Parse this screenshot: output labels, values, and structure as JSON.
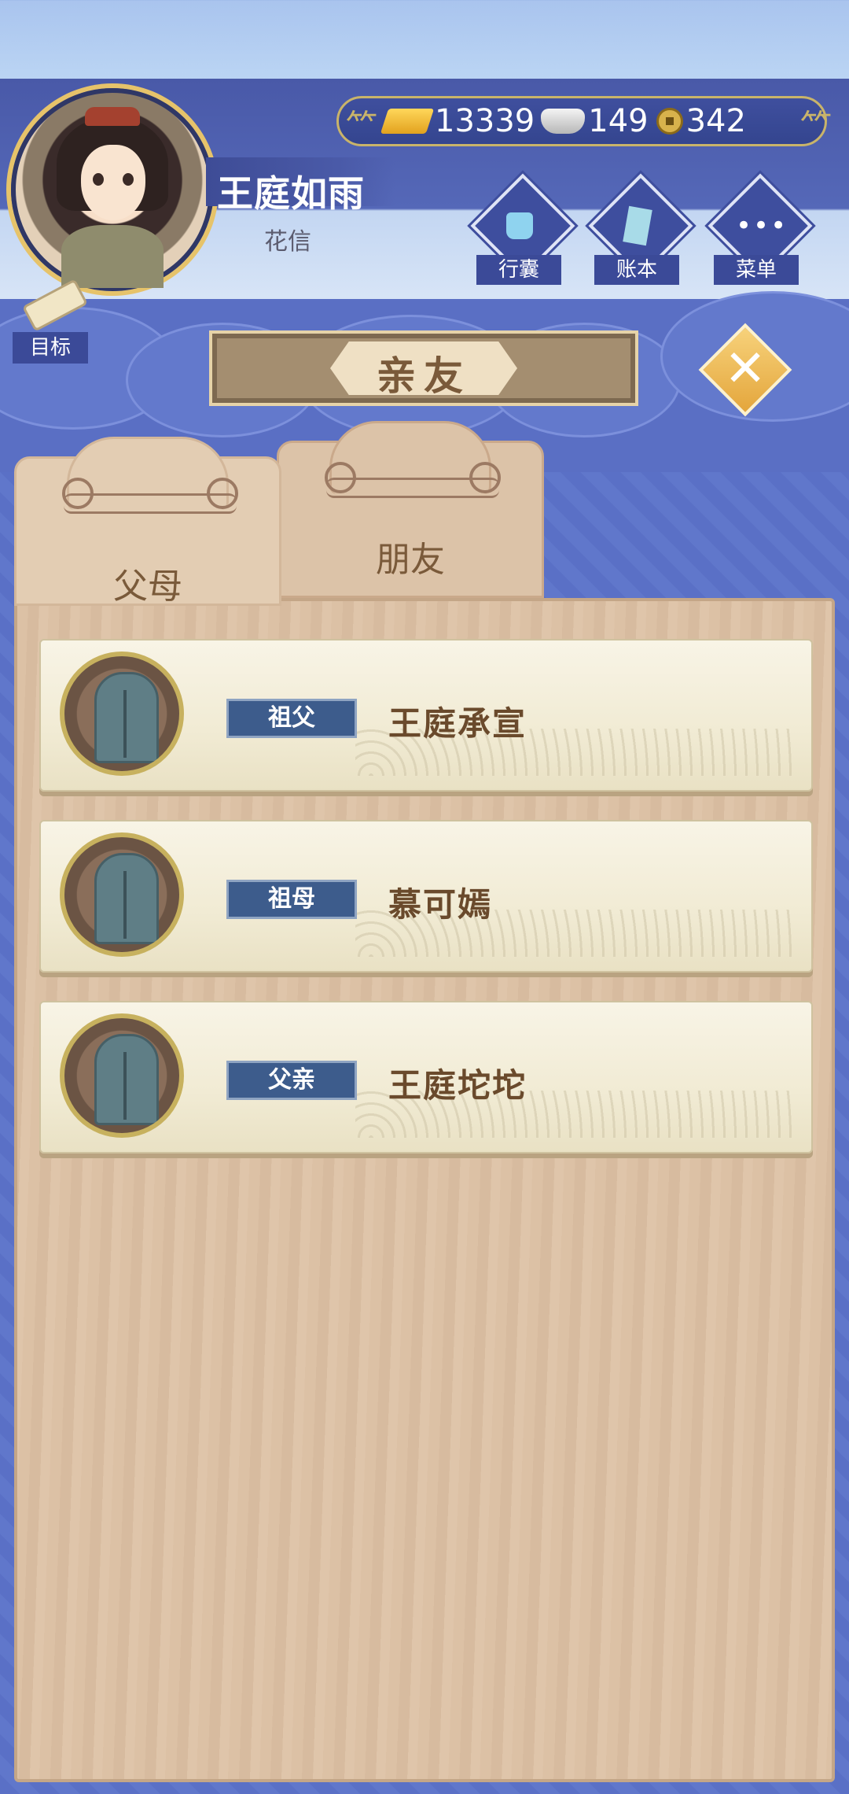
{
  "player": {
    "name": "王庭如雨",
    "title": "花信"
  },
  "currency": {
    "gold": "13339",
    "silver": "149",
    "coins": "342"
  },
  "top_buttons": [
    {
      "label": "行囊",
      "icon": "bag-icon"
    },
    {
      "label": "账本",
      "icon": "ledger-icon"
    },
    {
      "label": "菜单",
      "icon": "menu-icon"
    }
  ],
  "goal": {
    "label": "目标"
  },
  "panel": {
    "title": "亲友",
    "close_icon": "✕"
  },
  "tabs": [
    {
      "label": "父母",
      "active": true
    },
    {
      "label": "朋友",
      "active": false
    }
  ],
  "relatives": [
    {
      "relation": "祖父",
      "name": "王庭承宣"
    },
    {
      "relation": "祖母",
      "name": "慕可嫣"
    },
    {
      "relation": "父亲",
      "name": "王庭坨坨"
    }
  ],
  "colors": {
    "accent_blue": "#3e4e9e",
    "panel_wood": "#dcc1a5",
    "badge_blue": "#3d5c8c",
    "gold_border": "#c9b46a"
  }
}
